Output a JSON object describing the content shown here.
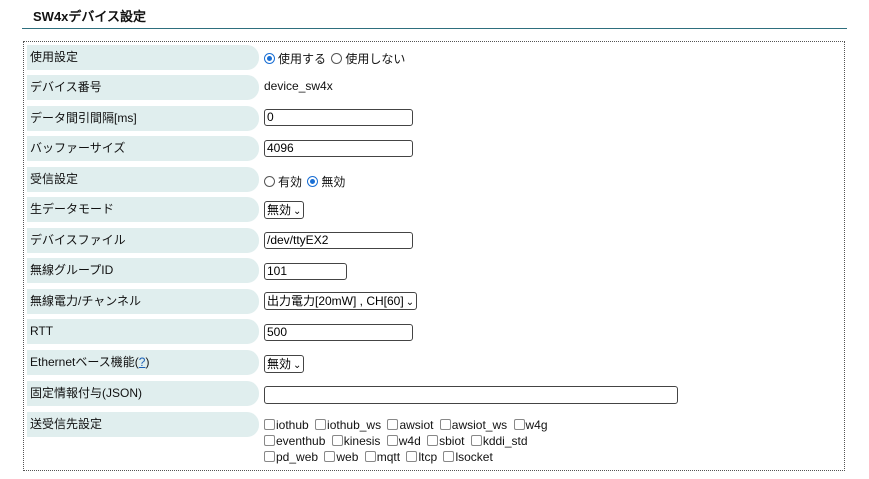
{
  "title": "SW4xデバイス設定",
  "rows": {
    "use": {
      "label": "使用設定",
      "opt_yes": "使用する",
      "opt_no": "使用しない",
      "selected": "yes"
    },
    "device_no": {
      "label": "デバイス番号",
      "value": "device_sw4x"
    },
    "interval": {
      "label": "データ間引間隔[ms]",
      "value": "0"
    },
    "buffer": {
      "label": "バッファーサイズ",
      "value": "4096"
    },
    "receive": {
      "label": "受信設定",
      "opt_on": "有効",
      "opt_off": "無効",
      "selected": "off"
    },
    "raw_mode": {
      "label": "生データモード",
      "value": "無効"
    },
    "device_file": {
      "label": "デバイスファイル",
      "value": "/dev/ttyEX2"
    },
    "group_id": {
      "label": "無線グループID",
      "value": "101"
    },
    "power": {
      "label": "無線電力/チャンネル",
      "value": "出力電力[20mW] , CH[60]"
    },
    "rtt": {
      "label": "RTT",
      "value": "500"
    },
    "ethernet": {
      "label_prefix": "Ethernetベース機能(",
      "help": "?",
      "label_suffix": ")",
      "value": "無効"
    },
    "fixed_info": {
      "label": "固定情報付与(JSON)",
      "value": ""
    },
    "destinations": {
      "label": "送受信先設定",
      "lines": [
        [
          "iothub",
          "iothub_ws",
          "awsiot",
          "awsiot_ws",
          "w4g"
        ],
        [
          "eventhub",
          "kinesis",
          "w4d",
          "sbiot",
          "kddi_std"
        ],
        [
          "pd_web",
          "web",
          "mqtt",
          "ltcp",
          "lsocket"
        ]
      ]
    }
  },
  "colors": {
    "label_bg": "#e0eeee",
    "rule": "#2e6f7e",
    "radio": "#1a6fd4"
  },
  "icons": {
    "dropdown": "chevron-down-icon"
  }
}
